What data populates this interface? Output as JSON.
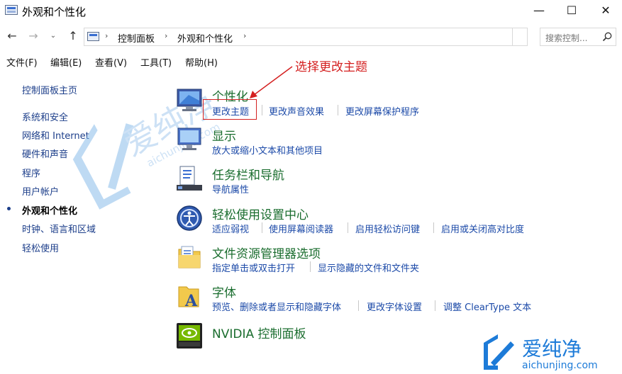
{
  "window": {
    "title": "外观和个性化",
    "controls": {
      "minimize": "—",
      "maximize": "☐",
      "close": "✕"
    }
  },
  "nav": {
    "back": "←",
    "forward": "→",
    "dropdown": "⌄",
    "up": "↑"
  },
  "address": {
    "breadcrumbs": [
      "控制面板",
      "外观和个性化"
    ],
    "separator": "›"
  },
  "search": {
    "placeholder": "搜索控制..."
  },
  "menu": [
    "文件(F)",
    "编辑(E)",
    "查看(V)",
    "工具(T)",
    "帮助(H)"
  ],
  "sidebar": {
    "home": "控制面板主页",
    "items": [
      "系统和安全",
      "网络和 Internet",
      "硬件和声音",
      "程序",
      "用户帐户",
      "外观和个性化",
      "时钟、语言和区域",
      "轻松使用"
    ],
    "current_index": 5
  },
  "categories": [
    {
      "title": "个性化",
      "icon": "personalization-icon",
      "links": [
        "更改主题",
        "更改声音效果",
        "更改屏幕保护程序"
      ]
    },
    {
      "title": "显示",
      "icon": "display-icon",
      "links": [
        "放大或缩小文本和其他项目"
      ]
    },
    {
      "title": "任务栏和导航",
      "icon": "taskbar-icon",
      "links": [
        "导航属性"
      ]
    },
    {
      "title": "轻松使用设置中心",
      "icon": "ease-of-access-icon",
      "links": [
        "适应弱视",
        "使用屏幕阅读器",
        "启用轻松访问键",
        "启用或关闭高对比度"
      ]
    },
    {
      "title": "文件资源管理器选项",
      "icon": "folder-options-icon",
      "links": [
        "指定单击或双击打开",
        "显示隐藏的文件和文件夹"
      ]
    },
    {
      "title": "字体",
      "icon": "fonts-icon",
      "links": [
        "预览、删除或者显示和隐藏字体",
        "更改字体设置",
        "调整 ClearType 文本"
      ]
    },
    {
      "title": "NVIDIA 控制面板",
      "icon": "nvidia-icon",
      "links": []
    }
  ],
  "annotation": {
    "text": "选择更改主题",
    "color": "#d42020"
  },
  "watermark": {
    "brand": "爱纯净",
    "site": "aichunjing.com"
  },
  "colors": {
    "link": "#1c4aa8",
    "category_title": "#1a6d2e",
    "annotation": "#d42020"
  }
}
